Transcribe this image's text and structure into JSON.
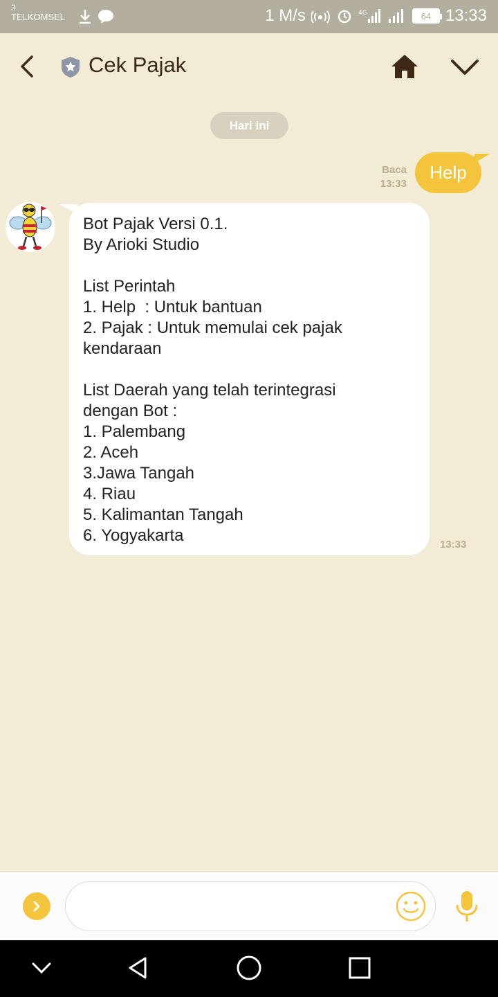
{
  "status_bar": {
    "sim_number": "3",
    "carrier": "TELKOMSEL",
    "speed": "1 M/s",
    "battery": "64",
    "time": "13:33"
  },
  "header": {
    "title": "Cek Pajak"
  },
  "chat": {
    "date_label": "Hari ini",
    "outgoing": {
      "text": "Help",
      "read_label": "Baca",
      "time": "13:33"
    },
    "incoming": {
      "lines": [
        "Bot Pajak Versi 0.1.",
        "By Arioki Studio",
        "",
        "List Perintah",
        "1. Help  : Untuk bantuan",
        "2. Pajak : Untuk memulai cek pajak",
        "kendaraan",
        "",
        "List Daerah yang telah terintegrasi",
        "dengan Bot :",
        "1. Palembang",
        "2. Aceh",
        "3.Jawa Tangah",
        "4. Riau",
        "5. Kalimantan Tangah",
        "6. Yogyakarta"
      ],
      "time": "13:33"
    }
  },
  "input": {
    "value": "",
    "placeholder": ""
  },
  "icons": {
    "back": "back-arrow-icon",
    "account": "shield-star-icon",
    "home": "home-icon",
    "menu": "chevron-down-icon",
    "expand": "chevron-right-icon",
    "emoji": "smiley-icon",
    "mic": "microphone-icon"
  },
  "colors": {
    "background": "#f2ebd6",
    "accent": "#f3c43c",
    "header_text": "#3e2a14",
    "status_bar": "#b4ae9e"
  }
}
